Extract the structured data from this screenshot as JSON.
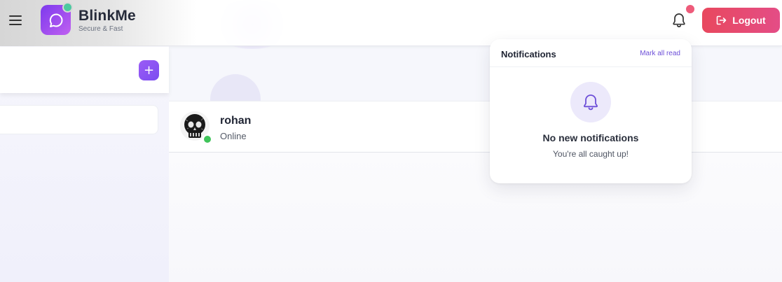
{
  "app": {
    "name": "BlinkMe",
    "tagline": "Secure & Fast",
    "colors": {
      "brand": "#7c3aed",
      "logout": "#e8485e",
      "online": "#3fc45a",
      "badge": "#ee5b7a"
    }
  },
  "header": {
    "menu_icon": "hamburger-menu-icon",
    "logo_icon": "chat-bubble-icon",
    "notifications_icon": "bell-icon",
    "logout_label": "Logout",
    "logout_icon": "logout-arrow-icon"
  },
  "sidebar": {
    "add_icon": "plus-icon",
    "add_label": "+"
  },
  "chat": {
    "contact_name": "rohan",
    "contact_status": "Online",
    "avatar_icon": "skull-avatar-image"
  },
  "notifications": {
    "title": "Notifications",
    "mark_all_read": "Mark all read",
    "empty_icon": "bell-icon",
    "empty_title": "No new notifications",
    "empty_subtitle": "You're all caught up!"
  }
}
